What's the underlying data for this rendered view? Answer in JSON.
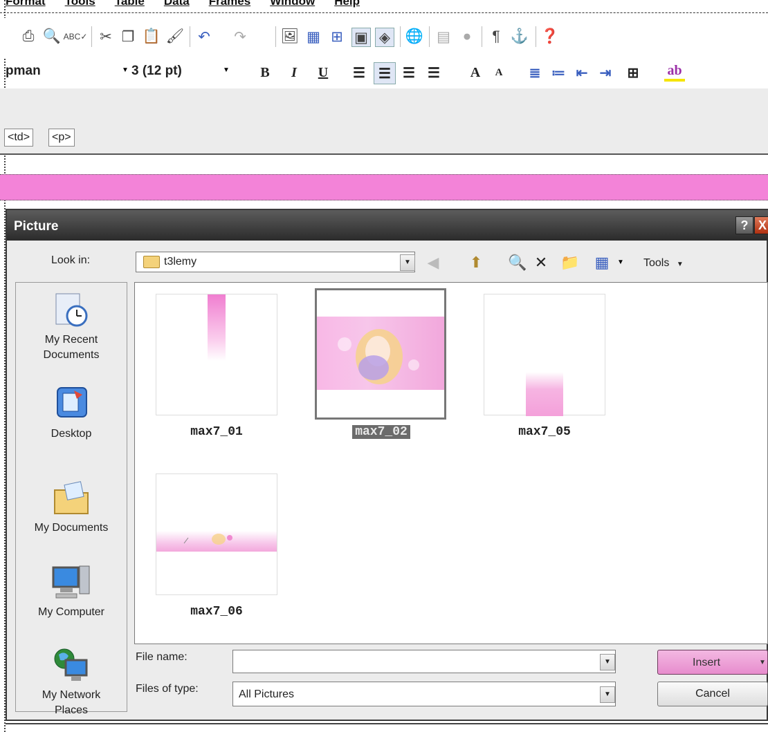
{
  "menubar": {
    "items": [
      "Format",
      "Tools",
      "Table",
      "Data",
      "Frames",
      "Window",
      "Help"
    ]
  },
  "toolbar1": {
    "icons": [
      "print-icon",
      "print-preview-icon",
      "spelling-icon",
      "cut-icon",
      "copy-icon",
      "paste-icon",
      "format-painter-icon",
      "undo-icon",
      "redo-icon",
      "insert-image-icon",
      "insert-table-icon",
      "frame-icon",
      "picture-icon",
      "layer-icon",
      "hyperlink-icon",
      "bookmark-icon",
      "record-icon",
      "paragraph-mark-icon",
      "anchor-icon",
      "help-icon"
    ]
  },
  "toolbar2": {
    "font_name": "pman",
    "font_size": "3 (12 pt)",
    "bold": "B",
    "italic": "I",
    "underline": "U",
    "grow_font": "A",
    "shrink_font": "A"
  },
  "tagbar": {
    "tags": [
      "<td>",
      "<p>"
    ]
  },
  "dialog": {
    "title": "Picture",
    "help_button": "?",
    "close_button": "X",
    "look_in_label": "Look in:",
    "look_in_value": "t3lemy",
    "tools_label": "Tools",
    "places": [
      {
        "label": "My Recent Documents",
        "icon": "recent-documents-icon"
      },
      {
        "label": "Desktop",
        "icon": "desktop-icon"
      },
      {
        "label": "My Documents",
        "icon": "my-documents-icon"
      },
      {
        "label": "My Computer",
        "icon": "my-computer-icon"
      },
      {
        "label": "My Network Places",
        "icon": "network-places-icon"
      }
    ],
    "files": [
      {
        "name": "max7_01",
        "selected": false
      },
      {
        "name": "max7_02",
        "selected": true
      },
      {
        "name": "max7_05",
        "selected": false
      },
      {
        "name": "max7_06",
        "selected": false
      }
    ],
    "file_name_label": "File name:",
    "file_name_value": "",
    "files_of_type_label": "Files of type:",
    "files_of_type_value": "All Pictures",
    "insert_button": "Insert",
    "cancel_button": "Cancel"
  },
  "colors": {
    "accent_pink": "#f383d8",
    "insert_pink": "#e78ccd",
    "title_bar": "#2b2b2b"
  }
}
